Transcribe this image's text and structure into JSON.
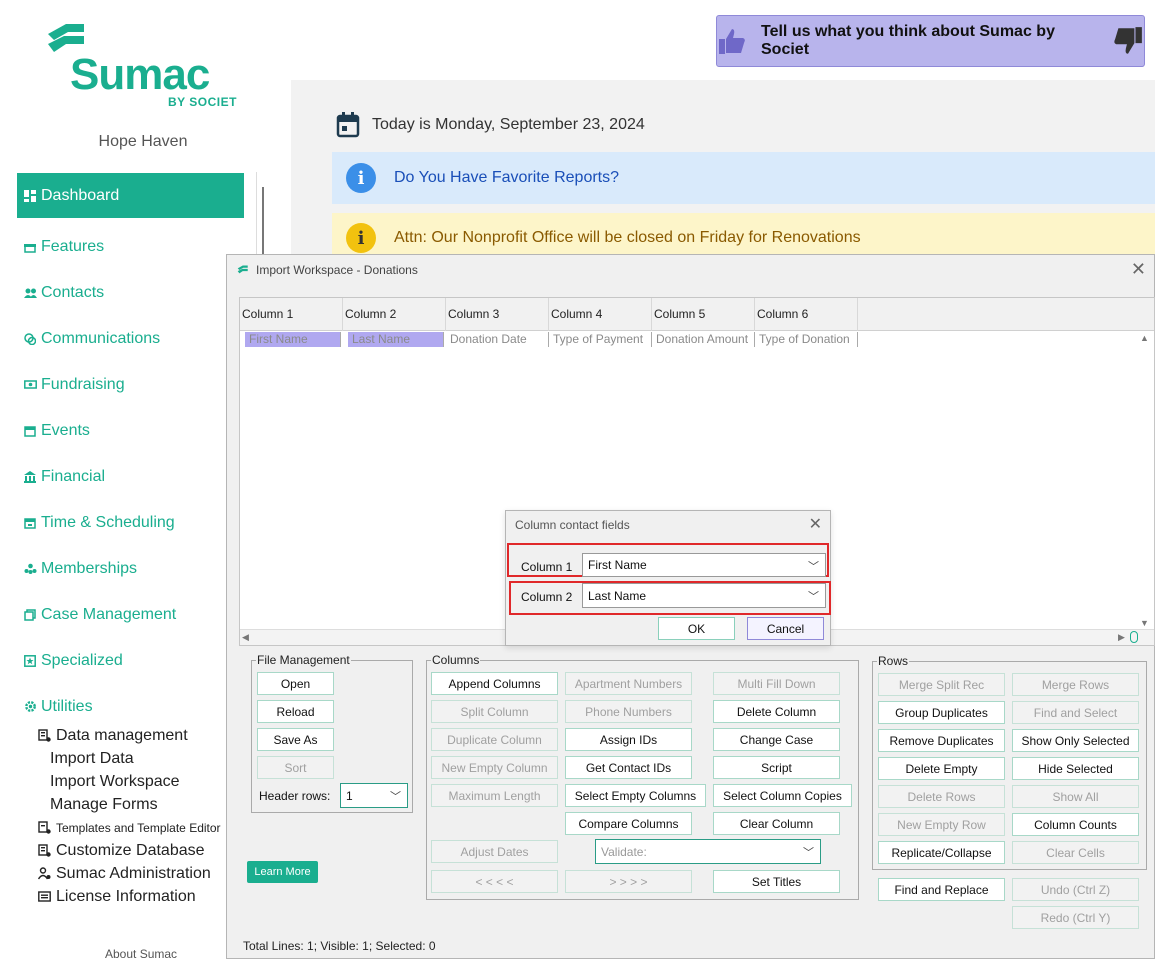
{
  "brand": {
    "name": "Sumac",
    "sub": "BY SOCIET",
    "org": "Hope Haven"
  },
  "feedback": {
    "label": "Tell us what you think about Sumac by Societ"
  },
  "date_text": "Today is Monday, September 23, 2024",
  "banners": {
    "info": "Do You Have Favorite Reports?",
    "attn": "Attn: Our Nonprofit Office will be closed on Friday for Renovations"
  },
  "nav": {
    "items": [
      {
        "label": "Dashboard",
        "icon": "dashboard-icon",
        "active": true
      },
      {
        "label": "Features",
        "icon": "gift-icon"
      },
      {
        "label": "Contacts",
        "icon": "people-icon"
      },
      {
        "label": "Communications",
        "icon": "chat-icon"
      },
      {
        "label": "Fundraising",
        "icon": "money-icon"
      },
      {
        "label": "Events",
        "icon": "calendar-icon"
      },
      {
        "label": "Financial",
        "icon": "bank-icon"
      },
      {
        "label": "Time & Scheduling",
        "icon": "clock-calendar-icon"
      },
      {
        "label": "Memberships",
        "icon": "group-icon"
      },
      {
        "label": "Case Management",
        "icon": "folder-icon"
      },
      {
        "label": "Specialized",
        "icon": "star-box-icon"
      },
      {
        "label": "Utilities",
        "icon": "gear-icon"
      }
    ],
    "utilities_sub": {
      "data_management": "Data management",
      "import_data": "Import Data",
      "import_workspace": "Import Workspace",
      "manage_forms": "Manage Forms",
      "templates": "Templates and Template Editor",
      "customize_db": "Customize Database",
      "admin": "Sumac Administration",
      "license": "License Information"
    },
    "about": "About Sumac"
  },
  "import_workspace": {
    "title": "Import Workspace - Donations",
    "columns": [
      "Column 1",
      "Column 2",
      "Column 3",
      "Column 4",
      "Column 5",
      "Column 6"
    ],
    "row": [
      "First Name",
      "Last Name",
      "Donation Date",
      "Type of Payment",
      "Donation Amount",
      "Type of Donation"
    ],
    "groups": {
      "file": "File Management",
      "columns": "Columns",
      "rows": "Rows"
    },
    "file_buttons": {
      "open": "Open",
      "reload": "Reload",
      "save_as": "Save As",
      "sort": "Sort"
    },
    "header_rows_label": "Header rows:",
    "header_rows_value": "1",
    "col_buttons": {
      "append": "Append Columns",
      "apt": "Apartment Numbers",
      "multi_fill": "Multi Fill Down",
      "split": "Split Column",
      "phone": "Phone Numbers",
      "delete": "Delete Column",
      "duplicate": "Duplicate Column",
      "assign_ids": "Assign IDs",
      "change_case": "Change Case",
      "new_empty": "New Empty Column",
      "get_ids": "Get Contact IDs",
      "script": "Script",
      "max_len": "Maximum Length",
      "select_empty": "Select Empty Columns",
      "select_copies": "Select Column Copies",
      "compare": "Compare Columns",
      "clear": "Clear Column",
      "adjust_dates": "Adjust Dates",
      "prev": "< < < <",
      "next": "> > > >",
      "set_titles": "Set Titles"
    },
    "validate_placeholder": "Validate:",
    "row_buttons": {
      "merge_split": "Merge Split Rec",
      "merge_rows": "Merge Rows",
      "group_dup": "Group Duplicates",
      "find_select": "Find and Select",
      "remove_dup": "Remove Duplicates",
      "show_only": "Show Only Selected",
      "delete_empty": "Delete Empty",
      "hide_selected": "Hide Selected",
      "delete_rows": "Delete Rows",
      "show_all": "Show All",
      "new_empty_row": "New Empty Row",
      "col_counts": "Column Counts",
      "replicate": "Replicate/Collapse",
      "clear_cells": "Clear Cells",
      "find_replace": "Find and Replace",
      "undo": "Undo (Ctrl Z)",
      "redo": "Redo (Ctrl Y)"
    },
    "learn_more": "Learn More",
    "status": "Total Lines: 1; Visible: 1; Selected: 0"
  },
  "dialog": {
    "title": "Column contact fields",
    "rows": [
      {
        "label": "Column 1",
        "value": "First Name"
      },
      {
        "label": "Column 2",
        "value": "Last Name"
      }
    ],
    "ok": "OK",
    "cancel": "Cancel"
  },
  "colors": {
    "brand": "#1aae8f",
    "highlight": "#e0282a",
    "selection": "#b0a8f0"
  }
}
